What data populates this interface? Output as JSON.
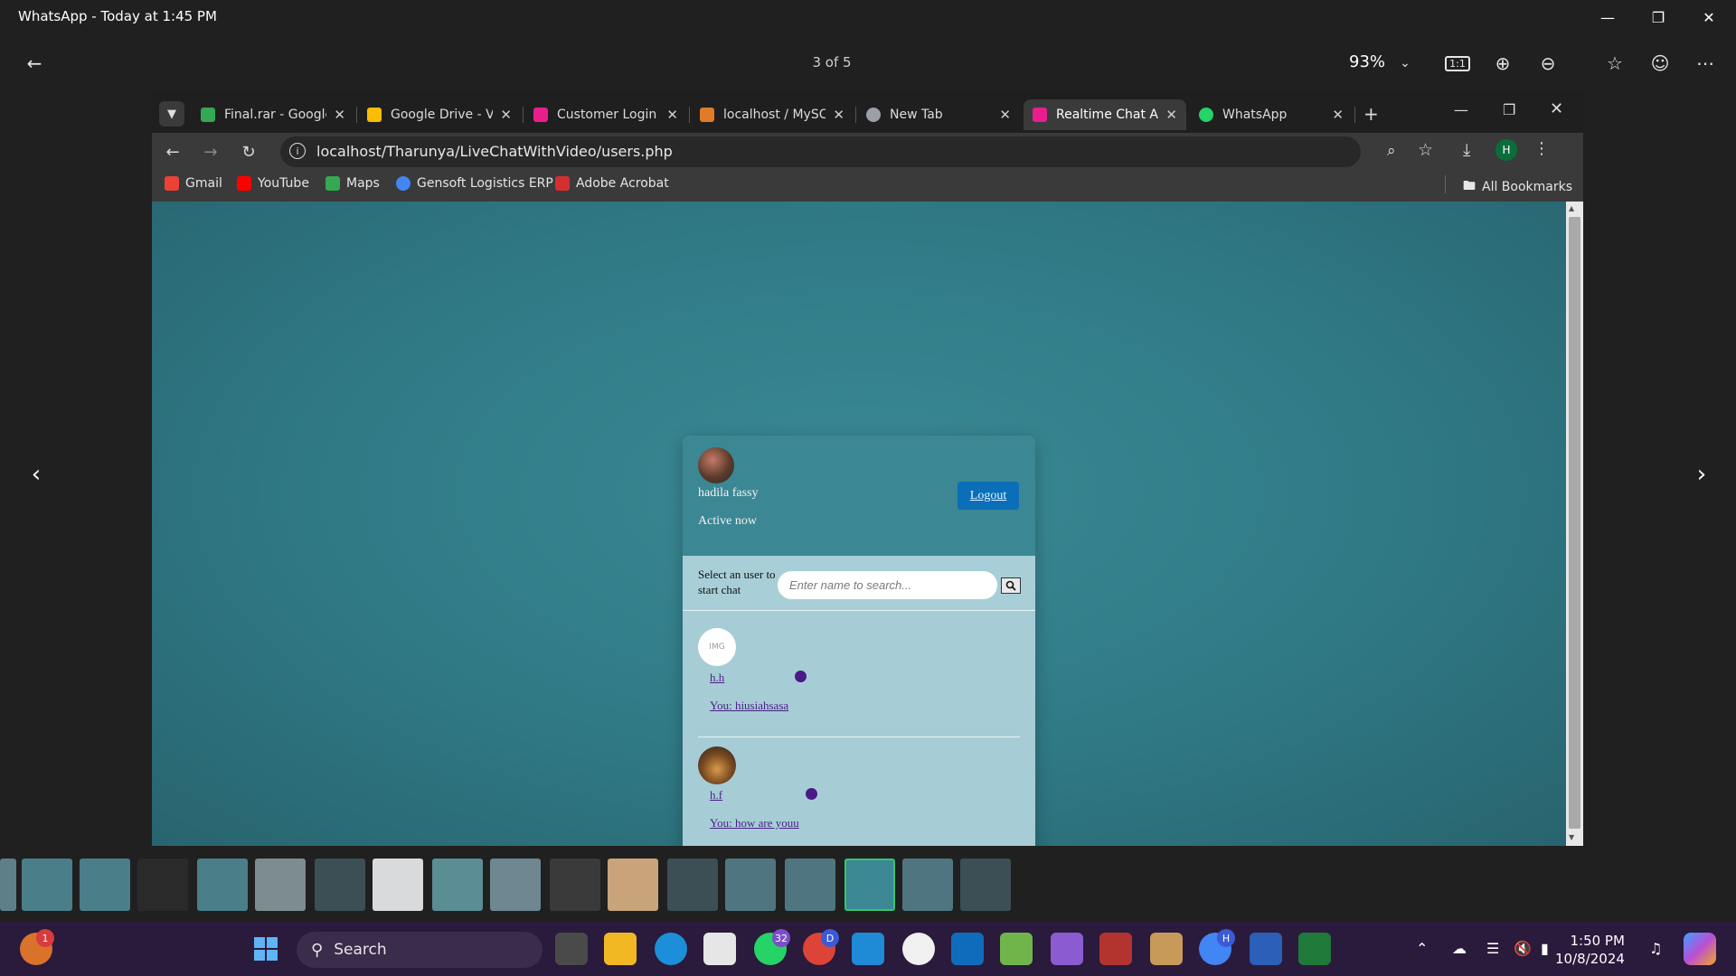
{
  "window": {
    "title": "WhatsApp - Today at 1:45 PM"
  },
  "viewer": {
    "page_count": "3 of 5",
    "zoom": "93%"
  },
  "browser": {
    "tabs": [
      {
        "label": "Final.rar - Google",
        "color": "#34a853"
      },
      {
        "label": "Google Drive - V",
        "color": "#fbbc04"
      },
      {
        "label": "Customer Login",
        "color": "#e91e8c"
      },
      {
        "label": "localhost / MySC",
        "color": "#e07b2a"
      },
      {
        "label": "New Tab",
        "color": "#9aa0a6"
      },
      {
        "label": "Realtime Chat Ap",
        "color": "#e91e8c"
      },
      {
        "label": "WhatsApp",
        "color": "#25d366"
      }
    ],
    "active_tab_index": 5,
    "url": "localhost/Tharunya/LiveChatWithVideo/users.php",
    "profile_initial": "H",
    "bookmarks": [
      {
        "label": "Gmail",
        "color": "#ea4335"
      },
      {
        "label": "YouTube",
        "color": "#ff0000"
      },
      {
        "label": "Maps",
        "color": "#34a853"
      },
      {
        "label": "Gensoft Logistics ERP",
        "color": "#4285f4"
      },
      {
        "label": "Adobe Acrobat",
        "color": "#d32f2f"
      }
    ],
    "all_bookmarks": "All Bookmarks"
  },
  "chat": {
    "user_name": "hadila fassy",
    "status": "Active now",
    "logout_label": "Logout",
    "search_label": "Select an user to start chat",
    "search_placeholder": "Enter name to search...",
    "users": [
      {
        "name": "h.h",
        "last_message": "You: hiusiahsasa",
        "avatar_text": "IMG"
      },
      {
        "name": "h.f",
        "last_message": "You: how are youu",
        "avatar_text": ""
      }
    ]
  },
  "taskbar": {
    "search_label": "Search",
    "whatsapp_badge": "32",
    "widget_badge": "1",
    "chrome_badge": "D",
    "chrome2_badge": "H",
    "time": "1:50 PM",
    "date": "10/8/2024"
  },
  "icons": [
    "back-arrow-icon",
    "minimize-icon",
    "maximize-icon",
    "close-icon",
    "zoom-in-icon",
    "zoom-out-icon",
    "star-icon",
    "emoji-icon",
    "more-icon",
    "search-icon",
    "download-icon",
    "reload-icon",
    "folder-icon",
    "windows-start-icon"
  ]
}
